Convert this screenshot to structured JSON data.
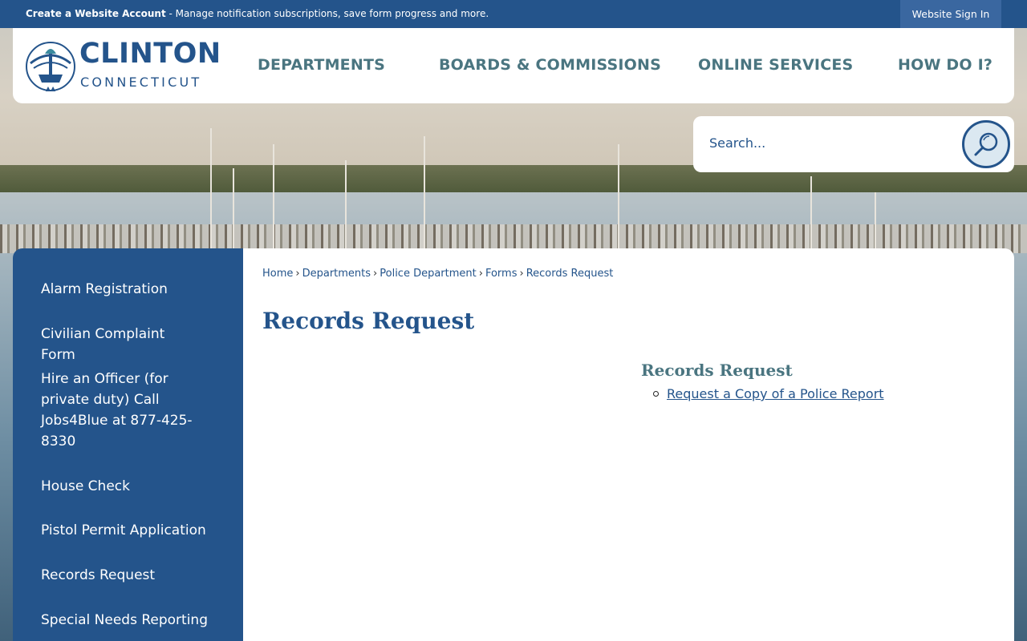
{
  "topbar": {
    "account_bold": "Create a Website Account",
    "account_rest": " - Manage notification subscriptions, save form progress and more.",
    "signin_label": "Website Sign In"
  },
  "header": {
    "logo_title": "CLINTON",
    "logo_subtitle": "CONNECTICUT",
    "nav": [
      "DEPARTMENTS",
      "BOARDS & COMMISSIONS",
      "ONLINE SERVICES",
      "HOW DO I?"
    ]
  },
  "search": {
    "placeholder": "Search..."
  },
  "sidebar": {
    "items": [
      "Alarm Registration",
      "Civilian Complaint Form",
      "Hire an Officer (for private duty) Call Jobs4Blue at 877-425-8330",
      "House Check",
      "Pistol Permit Application",
      "Records Request",
      "Special Needs Reporting"
    ]
  },
  "main": {
    "breadcrumb": [
      "Home",
      "Departments",
      "Police Department",
      "Forms",
      "Records Request"
    ],
    "breadcrumb_sep": "›",
    "page_title": "Records Request",
    "section_title": "Records Request",
    "link_label": "Request a Copy of a Police Report"
  },
  "colors": {
    "brand_blue": "#24548b",
    "nav_teal": "#4a7580"
  },
  "icons": {
    "search": "magnifier-icon",
    "logo": "town-seal-icon"
  }
}
